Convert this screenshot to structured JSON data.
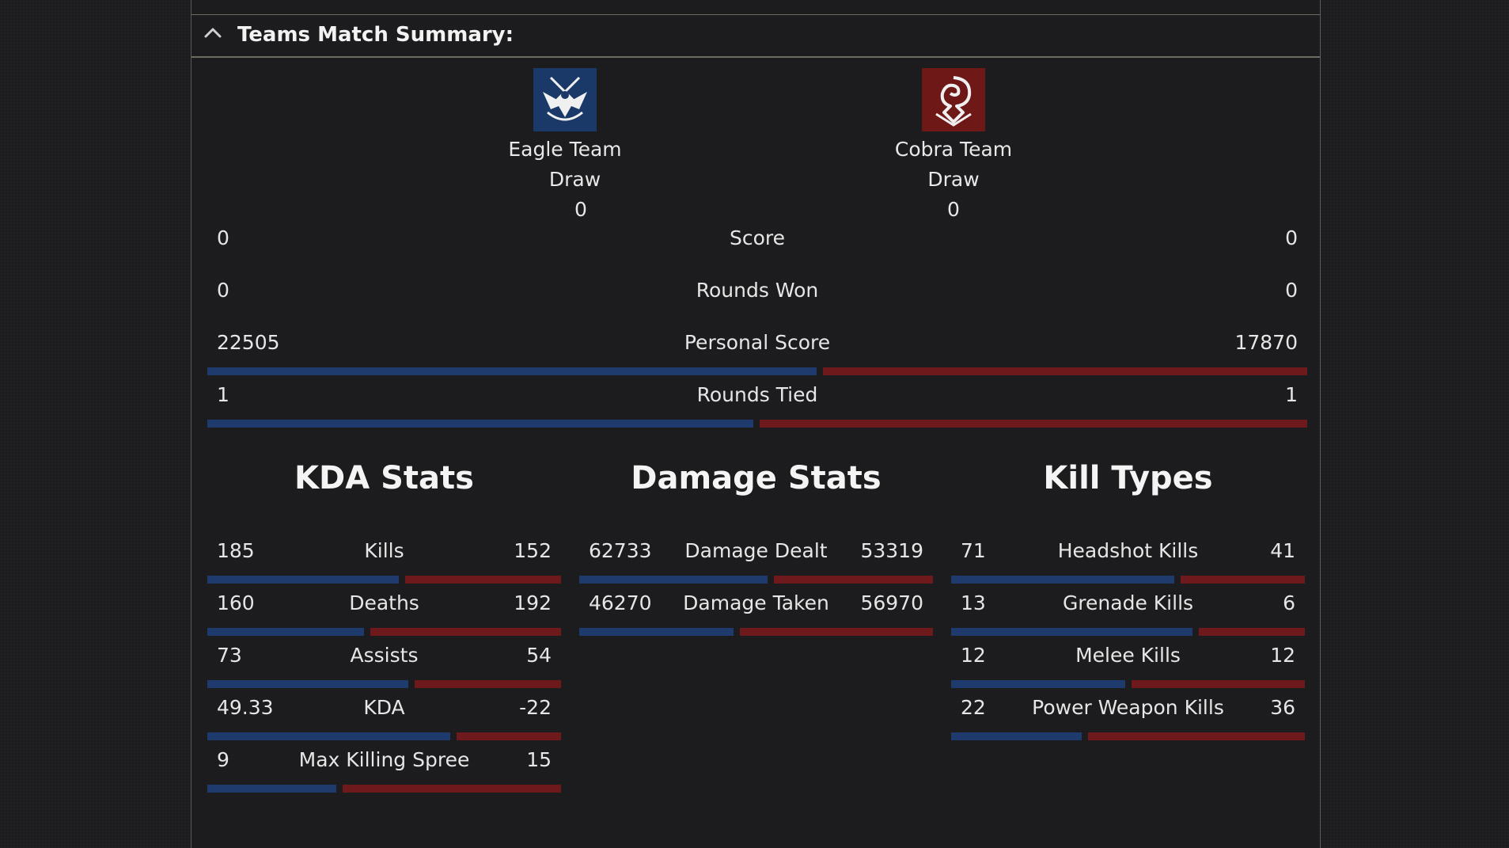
{
  "header": {
    "title": "Teams Match Summary:"
  },
  "teams": {
    "left": {
      "name": "Eagle Team",
      "result": "Draw",
      "score": "0",
      "color": "#1f3b6e"
    },
    "right": {
      "name": "Cobra Team",
      "result": "Draw",
      "score": "0",
      "color": "#6e1a1c"
    }
  },
  "summary": [
    {
      "label": "Score",
      "left": "0",
      "right": "0"
    },
    {
      "label": "Rounds Won",
      "left": "0",
      "right": "0"
    },
    {
      "label": "Personal Score",
      "left": "22505",
      "right": "17870"
    },
    {
      "label": "Rounds Tied",
      "left": "1",
      "right": "1"
    }
  ],
  "kda": {
    "title": "KDA Stats",
    "rows": [
      {
        "label": "Kills",
        "left": "185",
        "right": "152"
      },
      {
        "label": "Deaths",
        "left": "160",
        "right": "192"
      },
      {
        "label": "Assists",
        "left": "73",
        "right": "54"
      },
      {
        "label": "KDA",
        "left": "49.33",
        "right": "-22"
      },
      {
        "label": "Max Killing Spree",
        "left": "9",
        "right": "15"
      }
    ]
  },
  "damage": {
    "title": "Damage Stats",
    "rows": [
      {
        "label": "Damage Dealt",
        "left": "62733",
        "right": "53319"
      },
      {
        "label": "Damage Taken",
        "left": "46270",
        "right": "56970"
      }
    ]
  },
  "kills": {
    "title": "Kill Types",
    "rows": [
      {
        "label": "Headshot Kills",
        "left": "71",
        "right": "41"
      },
      {
        "label": "Grenade Kills",
        "left": "13",
        "right": "6"
      },
      {
        "label": "Melee Kills",
        "left": "12",
        "right": "12"
      },
      {
        "label": "Power Weapon Kills",
        "left": "22",
        "right": "36"
      }
    ]
  },
  "colors": {
    "team_blue": "#1f3b6e",
    "team_red": "#6e1a1c",
    "divider": "#6e6a5e"
  },
  "icons": {
    "collapse": "chevron-up-icon",
    "eagle": "eagle-emblem-icon",
    "cobra": "cobra-emblem-icon"
  }
}
